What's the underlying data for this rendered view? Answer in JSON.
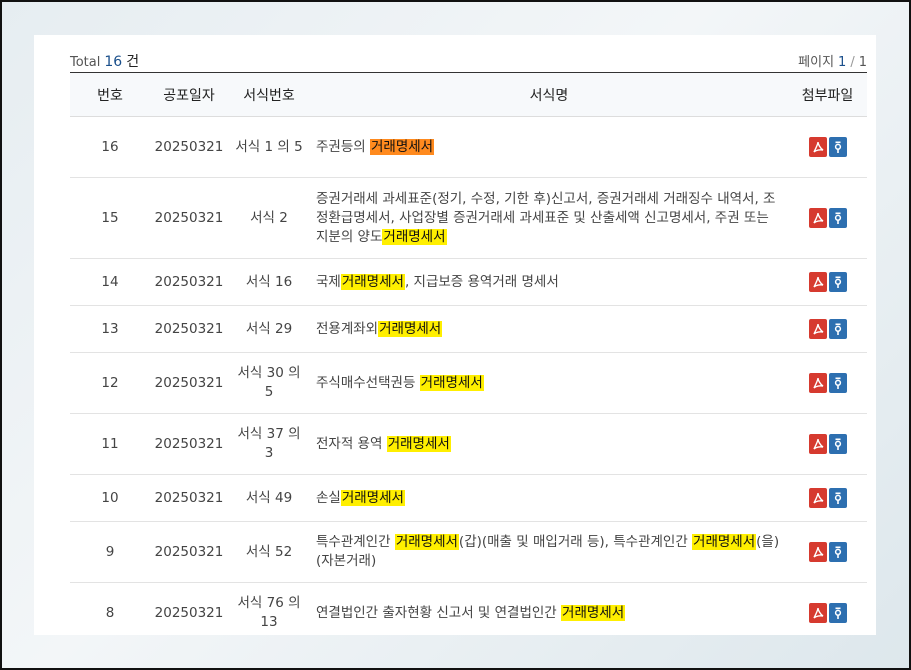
{
  "summary": {
    "total_label": "Total",
    "total_count": "16",
    "total_unit": "건",
    "page_label": "페이지",
    "current_page": "1",
    "separator": "/",
    "total_pages": "1"
  },
  "columns": [
    "번호",
    "공포일자",
    "서식번호",
    "서식명",
    "첨부파일"
  ],
  "rows": [
    {
      "no": "16",
      "date": "20250321",
      "form_no": "서식 1 의 5",
      "segments": [
        {
          "t": "주권등의 ",
          "h": ""
        },
        {
          "t": "거래명세서",
          "h": "orange"
        }
      ]
    },
    {
      "no": "15",
      "date": "20250321",
      "form_no": "서식 2",
      "segments": [
        {
          "t": "증권거래세 과세표준(정기, 수정, 기한 후)신고서, 증권거래세 거래징수 내역서, 조정환급명세서, 사업장별 증권거래세 과세표준 및 산출세액 신고명세서, 주권 또는 지분의 양도",
          "h": ""
        },
        {
          "t": "거래명세서",
          "h": "yellow"
        }
      ]
    },
    {
      "no": "14",
      "date": "20250321",
      "form_no": "서식 16",
      "segments": [
        {
          "t": "국제",
          "h": ""
        },
        {
          "t": "거래명세서",
          "h": "yellow"
        },
        {
          "t": ", 지급보증 용역거래 명세서",
          "h": ""
        }
      ]
    },
    {
      "no": "13",
      "date": "20250321",
      "form_no": "서식 29",
      "segments": [
        {
          "t": "전용계좌외",
          "h": ""
        },
        {
          "t": "거래명세서",
          "h": "yellow"
        }
      ]
    },
    {
      "no": "12",
      "date": "20250321",
      "form_no": "서식 30 의 5",
      "segments": [
        {
          "t": "주식매수선택권등 ",
          "h": ""
        },
        {
          "t": "거래명세서",
          "h": "yellow"
        }
      ]
    },
    {
      "no": "11",
      "date": "20250321",
      "form_no": "서식 37 의 3",
      "segments": [
        {
          "t": "전자적 용역 ",
          "h": ""
        },
        {
          "t": "거래명세서",
          "h": "yellow"
        }
      ]
    },
    {
      "no": "10",
      "date": "20250321",
      "form_no": "서식 49",
      "segments": [
        {
          "t": "손실",
          "h": ""
        },
        {
          "t": "거래명세서",
          "h": "yellow"
        }
      ]
    },
    {
      "no": "9",
      "date": "20250321",
      "form_no": "서식 52",
      "segments": [
        {
          "t": "특수관계인간 ",
          "h": ""
        },
        {
          "t": "거래명세서",
          "h": "yellow"
        },
        {
          "t": "(갑)(매출 및 매입거래 등), 특수관계인간 ",
          "h": ""
        },
        {
          "t": "거래명세서",
          "h": "yellow"
        },
        {
          "t": "(을)(자본거래)",
          "h": ""
        }
      ]
    },
    {
      "no": "8",
      "date": "20250321",
      "form_no": "서식 76 의 13",
      "segments": [
        {
          "t": "연결법인간 출자현황 신고서 및 연결법인간 ",
          "h": ""
        },
        {
          "t": "거래명세서",
          "h": "yellow"
        }
      ]
    }
  ]
}
